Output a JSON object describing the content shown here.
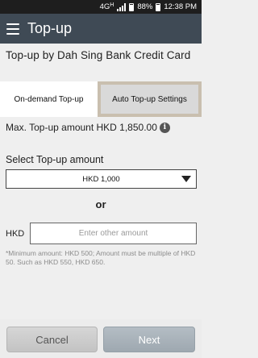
{
  "status_bar": {
    "network": "4G",
    "network_sub": "H",
    "battery": "88%",
    "time": "12:38 PM"
  },
  "header": {
    "title": "Top-up",
    "menu_icon": "hamburger-menu-icon"
  },
  "page": {
    "heading": "Top-up by Dah Sing Bank Credit Card"
  },
  "tabs": [
    {
      "label": "On-demand Top-up",
      "active": true
    },
    {
      "label": "Auto Top-up Settings",
      "active": false
    }
  ],
  "max_amount": {
    "text": "Max. Top-up amount HKD 1,850.00",
    "icon": "info-icon"
  },
  "select": {
    "label": "Select Top-up amount",
    "selected": "HKD 1,000"
  },
  "or_text": "or",
  "other_amount": {
    "label": "HKD",
    "placeholder": "Enter other amount",
    "value": ""
  },
  "note": "*Minimum amount: HKD 500; Amount must be multiple of HKD 50. Such as HKD 550, HKD 650.",
  "buttons": {
    "cancel": "Cancel",
    "next": "Next"
  },
  "colors": {
    "app_bar": "#3f4a55",
    "status_bar": "#1e1e1e",
    "next_button": "#a7b0b8",
    "cancel_button": "#cdcdcd",
    "inactive_tab_border": "#c9bfaf"
  }
}
